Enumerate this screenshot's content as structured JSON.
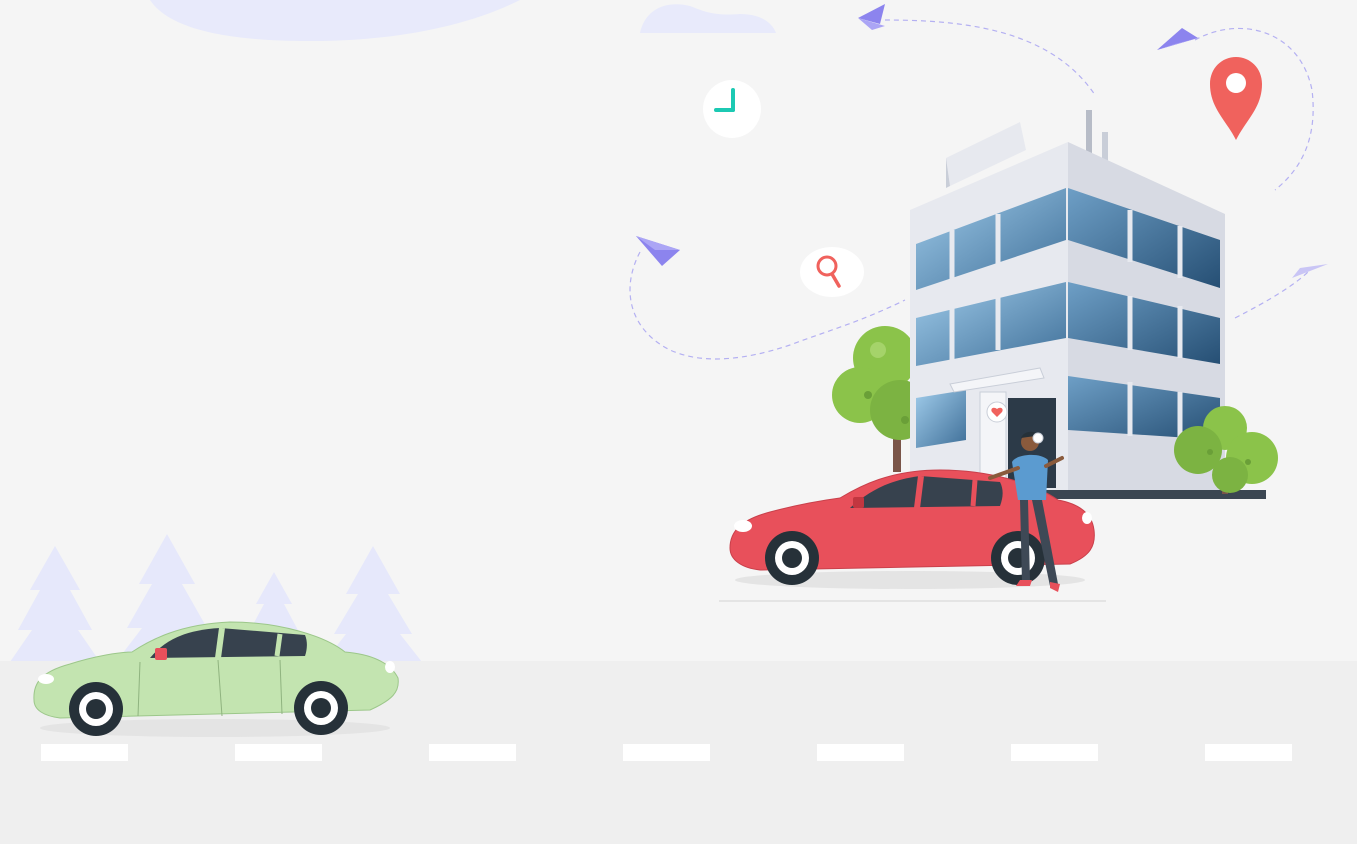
{
  "scene": {
    "colors": {
      "background": "#f5f5f5",
      "road": "#efefef",
      "road_marking": "#ffffff",
      "tree_silhouette": "#e6e8fb",
      "cloud": "#e8eafb",
      "green_car": "#c3e4b0",
      "red_car": "#e8505b",
      "paper_plane": "#8c84ee",
      "map_pin": "#f0625d",
      "clock_hand": "#1cc9b3",
      "tree_green": "#8bc34a",
      "building_glass": "#7fb0d6",
      "building_frame": "#e7e9ef"
    },
    "icons": [
      "clock-icon",
      "search-icon",
      "map-pin-icon",
      "paper-plane-icon",
      "heart-icon"
    ]
  }
}
